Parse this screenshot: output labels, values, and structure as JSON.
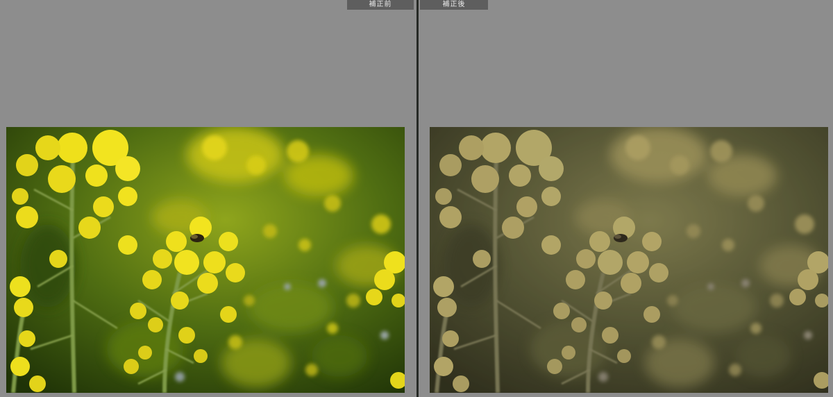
{
  "compare_view": {
    "before": {
      "label": "補正前"
    },
    "after": {
      "label": "補正後"
    }
  },
  "colors": {
    "background": "#8d8d8d",
    "label_bg": "#5e5e5e",
    "divider": "#272a26"
  }
}
